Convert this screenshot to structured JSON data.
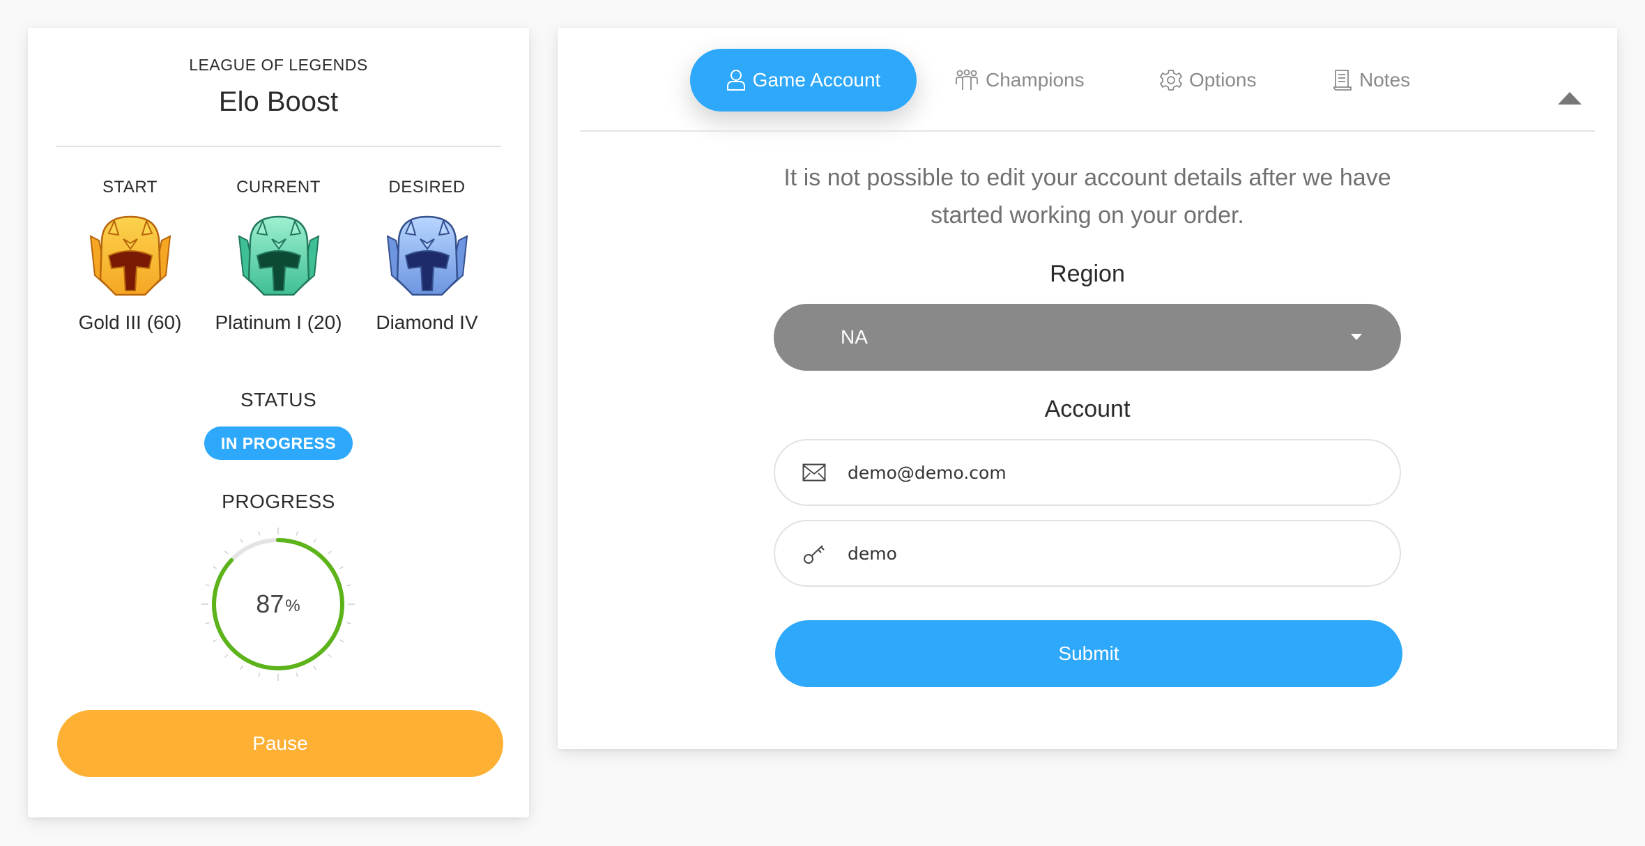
{
  "summary": {
    "game_name": "LEAGUE OF LEGENDS",
    "service_title": "Elo Boost",
    "ranks": [
      {
        "label": "START",
        "name": "Gold III (60)",
        "tier": "gold",
        "colors": {
          "light": "#fcd34d",
          "mid": "#f5a623",
          "dark": "#7a1a05",
          "outline": "#b8660b"
        }
      },
      {
        "label": "CURRENT",
        "name": "Platinum I (20)",
        "tier": "platinum",
        "colors": {
          "light": "#9ef0d0",
          "mid": "#3fbf95",
          "dark": "#0d4a34",
          "outline": "#22795e"
        }
      },
      {
        "label": "DESIRED",
        "name": "Diamond IV",
        "tier": "diamond",
        "colors": {
          "light": "#b8d6ff",
          "mid": "#6d95e0",
          "dark": "#1d2b6b",
          "outline": "#34508f"
        }
      }
    ],
    "status_label": "STATUS",
    "status_value": "IN PROGRESS",
    "progress_label": "PROGRESS",
    "progress_percent": 87,
    "progress_unit": "%",
    "pause_label": "Pause"
  },
  "tabs": [
    {
      "label": "Game Account",
      "icon": "user-icon",
      "active": true
    },
    {
      "label": "Champions",
      "icon": "group-icon",
      "active": false
    },
    {
      "label": "Options",
      "icon": "gear-icon",
      "active": false
    },
    {
      "label": "Notes",
      "icon": "notes-icon",
      "active": false
    }
  ],
  "account_form": {
    "notice": "It is not possible to edit your account details after we have started working on your order.",
    "region_label": "Region",
    "region_value": "NA",
    "account_label": "Account",
    "email_value": "demo@demo.com",
    "password_value": "demo",
    "submit_label": "Submit"
  },
  "colors": {
    "accent": "#2ea8fb",
    "pause": "#fdb034",
    "progress": "#5cb31a",
    "progress_track": "#e4e4e4",
    "select_bg": "#898989"
  }
}
